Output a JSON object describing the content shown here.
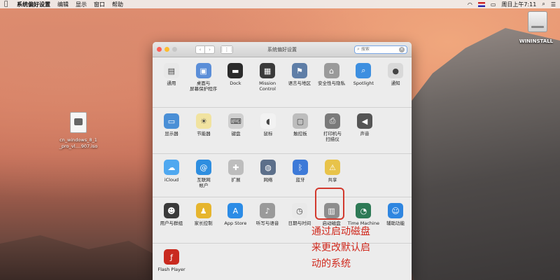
{
  "menubar": {
    "apple": "",
    "app_name": "系统偏好设置",
    "items": [
      "编辑",
      "显示",
      "窗口",
      "帮助"
    ],
    "clock": "周日上午7:11"
  },
  "desktop": {
    "disk_label": "WININSTALL",
    "iso_label_line1": "cn_windows_8_1",
    "iso_label_line2": "_pro_vl....907.iso"
  },
  "window": {
    "title": "系统偏好设置",
    "search_placeholder": "搜索",
    "nav_back": "‹",
    "nav_forward": "›",
    "grid_icon": "⋮⋮⋮"
  },
  "sections": [
    [
      {
        "label": "通用",
        "icon": "general-icon",
        "color": "#e8e8e8"
      },
      {
        "label": "桌面与\n屏幕保护程序",
        "icon": "desktop-icon",
        "color": "#5b8ed8"
      },
      {
        "label": "Dock",
        "icon": "dock-icon",
        "color": "#2b2b2b"
      },
      {
        "label": "Mission\nControl",
        "icon": "mission-control-icon",
        "color": "#3a3a3a"
      },
      {
        "label": "语言与地区",
        "icon": "language-icon",
        "color": "#5f7ea7"
      },
      {
        "label": "安全性与隐私",
        "icon": "security-icon",
        "color": "#9a9a9a"
      },
      {
        "label": "Spotlight",
        "icon": "spotlight-icon",
        "color": "#3d8fe0"
      },
      {
        "label": "通知",
        "icon": "notifications-icon",
        "color": "#d9d9d9"
      }
    ],
    [
      {
        "label": "显示器",
        "icon": "display-icon",
        "color": "#4a8fd6"
      },
      {
        "label": "节能器",
        "icon": "energy-saver-icon",
        "color": "#f1e3a0"
      },
      {
        "label": "键盘",
        "icon": "keyboard-icon",
        "color": "#cfcfcf"
      },
      {
        "label": "鼠标",
        "icon": "mouse-icon",
        "color": "#f2f2f2"
      },
      {
        "label": "触控板",
        "icon": "trackpad-icon",
        "color": "#bdbdbd"
      },
      {
        "label": "打印机与\n扫描仪",
        "icon": "printer-icon",
        "color": "#7a7a7a"
      },
      {
        "label": "声音",
        "icon": "sound-icon",
        "color": "#555555"
      }
    ],
    [
      {
        "label": "iCloud",
        "icon": "icloud-icon",
        "color": "#4fa8f0"
      },
      {
        "label": "互联网\n帐户",
        "icon": "internet-accounts-icon",
        "color": "#2e8ee0"
      },
      {
        "label": "扩展",
        "icon": "extensions-icon",
        "color": "#bdbdbd"
      },
      {
        "label": "网络",
        "icon": "network-icon",
        "color": "#5c6f8a"
      },
      {
        "label": "蓝牙",
        "icon": "bluetooth-icon",
        "color": "#3d7ad8"
      },
      {
        "label": "共享",
        "icon": "sharing-icon",
        "color": "#e8c34a"
      }
    ],
    [
      {
        "label": "用户与群组",
        "icon": "users-icon",
        "color": "#3a3a3a"
      },
      {
        "label": "家长控制",
        "icon": "parental-controls-icon",
        "color": "#e6b52e"
      },
      {
        "label": "App Store",
        "icon": "app-store-icon",
        "color": "#2c8ce6"
      },
      {
        "label": "听写与语音",
        "icon": "dictation-icon",
        "color": "#9a9a9a"
      },
      {
        "label": "日期与时间",
        "icon": "date-time-icon",
        "color": "#e9e9e9"
      },
      {
        "label": "启动磁盘",
        "icon": "startup-disk-icon",
        "color": "#8d8d8d"
      },
      {
        "label": "Time Machine",
        "icon": "time-machine-icon",
        "color": "#2e7a56"
      },
      {
        "label": "辅助功能",
        "icon": "accessibility-icon",
        "color": "#2f86e0"
      }
    ],
    [
      {
        "label": "Flash Player",
        "icon": "flash-player-icon",
        "color": "#c92a1f"
      }
    ]
  ],
  "annotation": {
    "line1": "通过启动磁盘",
    "line2": "来更改默认启",
    "line3": "动的系统"
  }
}
